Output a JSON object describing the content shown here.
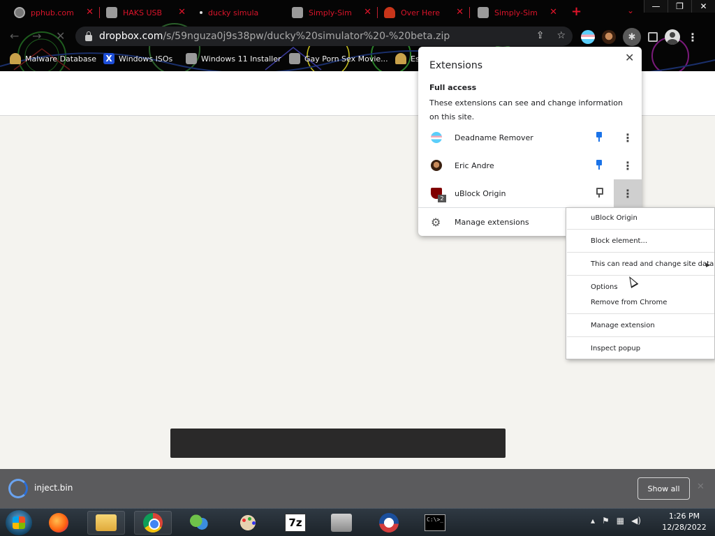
{
  "browser": {
    "tabs": [
      {
        "title": "pphub.com",
        "icon": "globe-icon"
      },
      {
        "title": "HAKS USB",
        "icon": "page-icon"
      },
      {
        "title": "ducky simula",
        "icon": "page-icon"
      },
      {
        "title": "Simply-Sim",
        "icon": "page-icon"
      },
      {
        "title": "Over Here",
        "icon": "person-icon"
      },
      {
        "title": "Simply-Sim",
        "icon": "page-icon"
      }
    ],
    "tab_close_glyph": "✕",
    "new_tab_glyph": "+",
    "tab_search_glyph": "⌄",
    "window_buttons": {
      "minimize": "—",
      "restore": "❐",
      "close": "✕"
    },
    "nav": {
      "back": "←",
      "forward": "→",
      "reload": "✕"
    },
    "url_host": "dropbox.com",
    "url_path": "/s/59nguza0j9s38pw/ducky%20simulator%20-%20beta.zip",
    "bookmarks": [
      {
        "title": "Malware Database",
        "icon": "person-icon"
      },
      {
        "title": "Windows ISOs",
        "icon": "x-icon"
      },
      {
        "title": "Windows 11 Installer",
        "icon": "page-icon"
      },
      {
        "title": "Gay Porn Sex Movie...",
        "icon": "page-icon"
      },
      {
        "title": "Es",
        "icon": "person-icon"
      }
    ]
  },
  "extensions_popup": {
    "title": "Extensions",
    "close_glyph": "✕",
    "section_title": "Full access",
    "section_desc": "These extensions can see and change information on this site.",
    "items": [
      {
        "name": "Deadname Remover",
        "pinned": true
      },
      {
        "name": "Eric Andre",
        "pinned": true
      },
      {
        "name": "uBlock Origin",
        "pinned": false,
        "badge": "2"
      }
    ],
    "more_glyph": "⋮",
    "manage_label": "Manage extensions"
  },
  "context_menu": {
    "items": [
      "uBlock Origin",
      "Block element...",
      "This can read and change site data",
      "Options",
      "Remove from Chrome",
      "Manage extension",
      "Inspect popup"
    ],
    "submenu_arrow": "▶"
  },
  "downloads": {
    "file_name": "inject.bin",
    "show_all_label": "Show all"
  },
  "taskbar": {
    "cmd_text": "C:\\>_",
    "seven_zip_label": "7z",
    "time": "1:26 PM",
    "date": "12/28/2022"
  },
  "colors": {
    "tab_text": "#d9142a",
    "accent_pin": "#1a73e8",
    "shelf_bg": "#5b5b5d",
    "page_bg": "#f4f3ef"
  }
}
